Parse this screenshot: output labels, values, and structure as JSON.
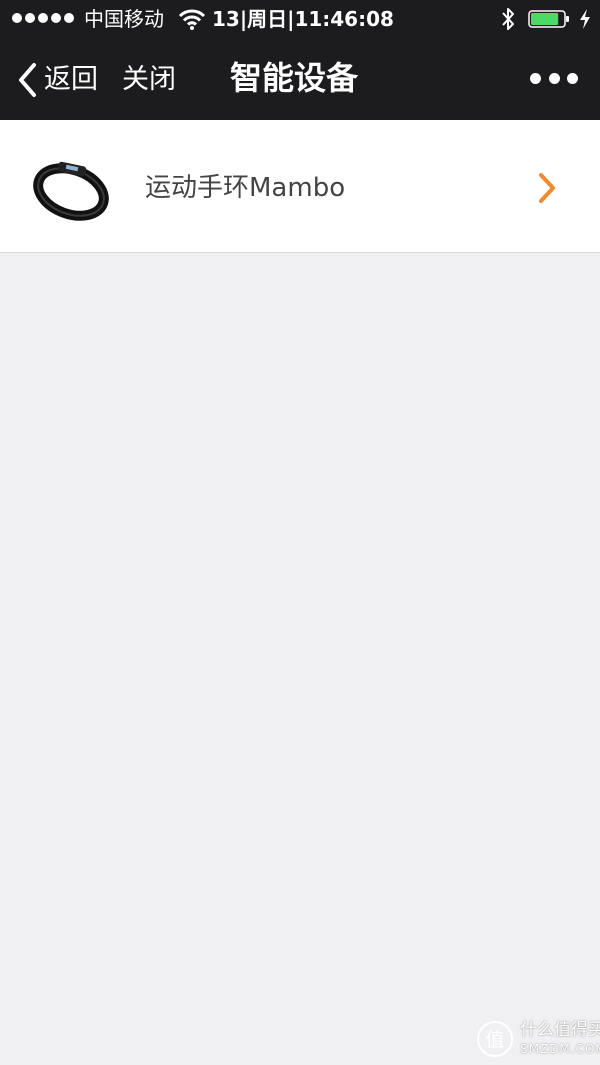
{
  "status_bar": {
    "carrier": "中国移动",
    "datetime": "13|周日|11:46:08",
    "signal_icon": "signal-dots-icon",
    "wifi_icon": "wifi-icon",
    "bluetooth_icon": "bluetooth-icon",
    "battery_icon": "battery-icon",
    "charging_icon": "charging-bolt-icon",
    "battery_level": 0.85,
    "battery_color": "#4cd964"
  },
  "nav": {
    "back_label": "返回",
    "close_label": "关闭",
    "title": "智能设备",
    "more_icon": "more-dots-icon"
  },
  "devices": [
    {
      "name": "运动手环Mambo",
      "icon": "wristband-icon",
      "chevron_color": "#f08a2c"
    }
  ],
  "watermark": {
    "text": "什么值得买",
    "sub": "SMZDM.COM",
    "badge_char": "值"
  },
  "colors": {
    "nav_background": "#1c1c1f",
    "page_background": "#f0f0f2",
    "accent": "#f08a2c"
  }
}
